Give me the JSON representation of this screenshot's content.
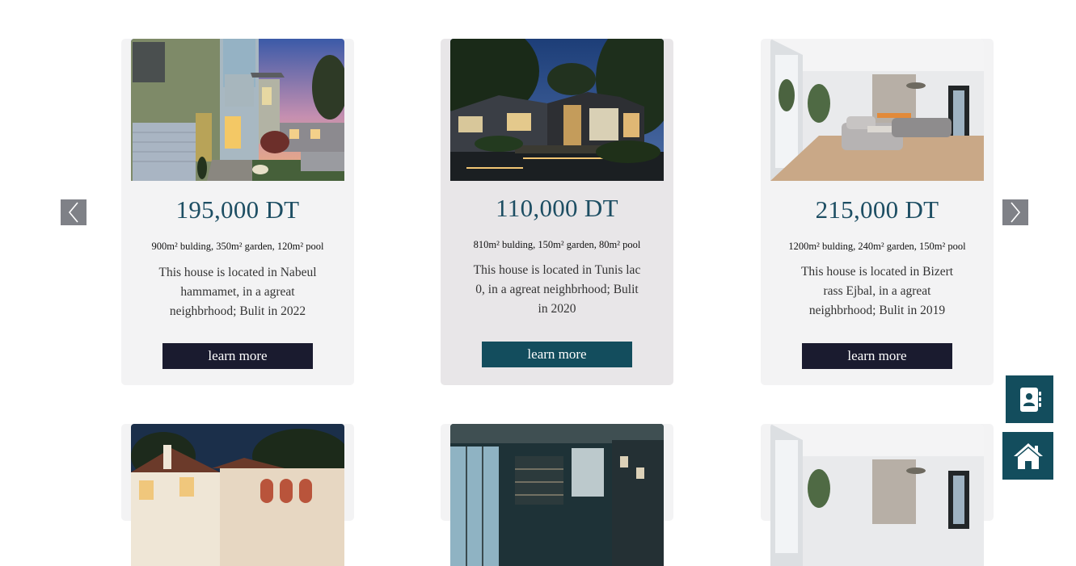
{
  "carousel": {
    "prev_icon": "chevron-left-icon",
    "next_icon": "chevron-right-icon",
    "cards": [
      {
        "price": "195,000 DT",
        "specs": "900m² bulding, 350m² garden, 120m² pool",
        "description": "This house is located in Nabeul hammamet, in a agreat neighbrhood; Bulit in 2022",
        "button_label": "learn more"
      },
      {
        "price": "110,000 DT",
        "specs": "810m² bulding, 150m² garden, 80m² pool",
        "description": "This house is located in Tunis lac 0, in a agreat neighbrhood; Bulit in 2020",
        "button_label": "learn more"
      },
      {
        "price": "215,000 DT",
        "specs": "1200m² bulding, 240m² garden, 150m² pool",
        "description": "This house is located in Bizert rass Ejbal, in a agreat neighbrhood; Bulit in 2019",
        "button_label": "learn more"
      }
    ]
  },
  "floating_buttons": {
    "contacts_icon": "address-book-icon",
    "home_icon": "home-icon"
  },
  "colors": {
    "price": "#1d4e63",
    "button_dark": "#1a1b2f",
    "button_teal": "#134d5d",
    "card_bg": "#f3f3f4",
    "card_active_bg": "#e8e6e8",
    "arrow_bg": "#7f8187"
  }
}
